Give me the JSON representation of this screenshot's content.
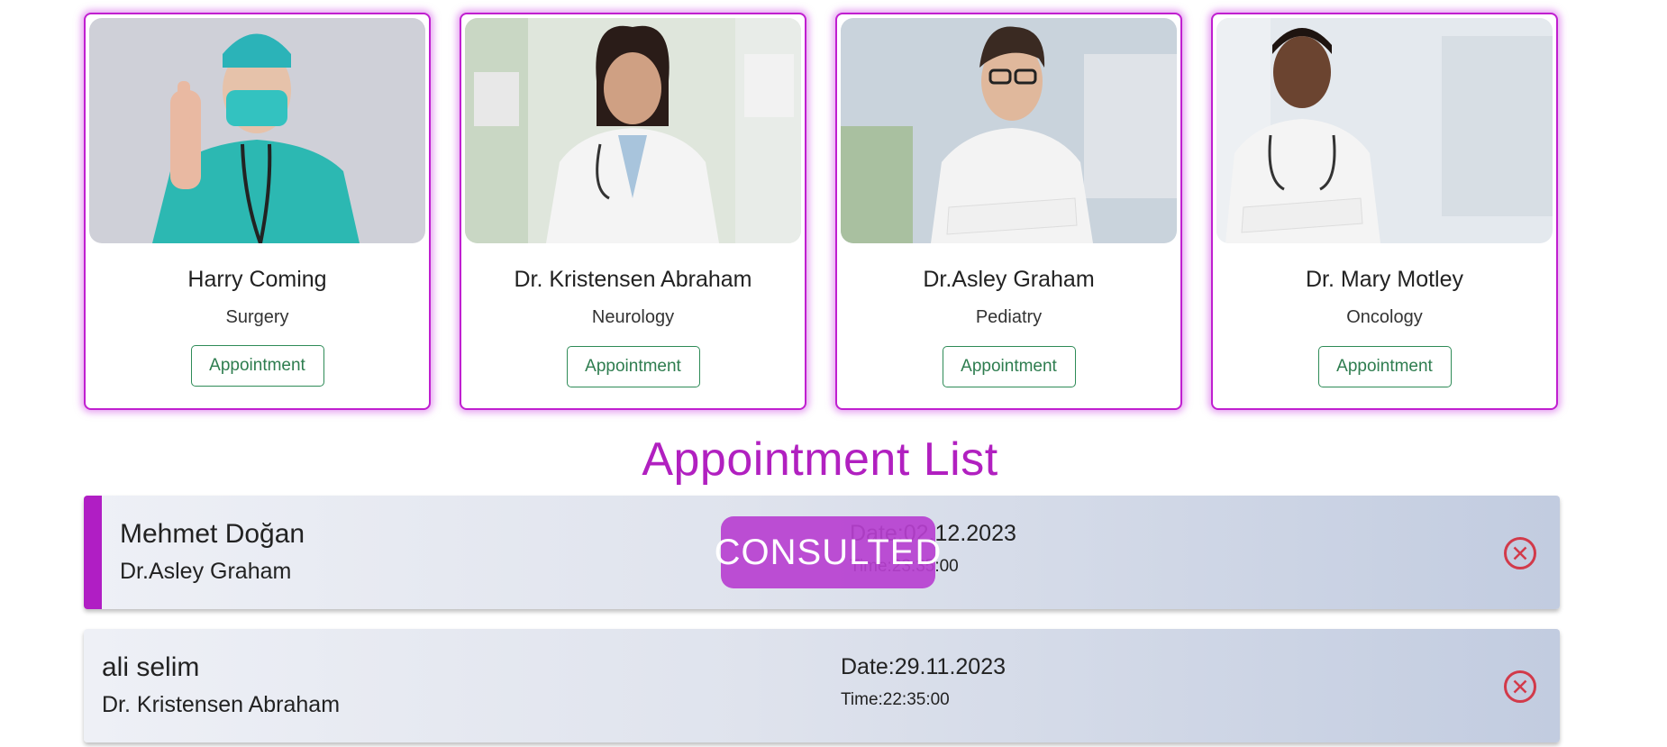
{
  "doctors": [
    {
      "name": "Harry Coming",
      "specialty": "Surgery",
      "button": "Appointment"
    },
    {
      "name": "Dr. Kristensen Abraham",
      "specialty": "Neurology",
      "button": "Appointment"
    },
    {
      "name": "Dr.Asley Graham",
      "specialty": "Pediatry",
      "button": "Appointment"
    },
    {
      "name": "Dr. Mary Motley",
      "specialty": "Oncology",
      "button": "Appointment"
    }
  ],
  "appointments_section": {
    "title": "Appointment List",
    "items": [
      {
        "patient": "Mehmet Doğan",
        "doctor": "Dr.Asley Graham",
        "date": "Date:02.12.2023",
        "time": "Time:23:35:00",
        "status": "CONSULTED"
      },
      {
        "patient": "ali selim",
        "doctor": "Dr. Kristensen Abraham",
        "date": "Date:29.11.2023",
        "time": "Time:22:35:00"
      }
    ]
  },
  "colors": {
    "accent": "#b01ec4",
    "button_border": "#2e8b57",
    "cancel": "#d23a4a"
  }
}
